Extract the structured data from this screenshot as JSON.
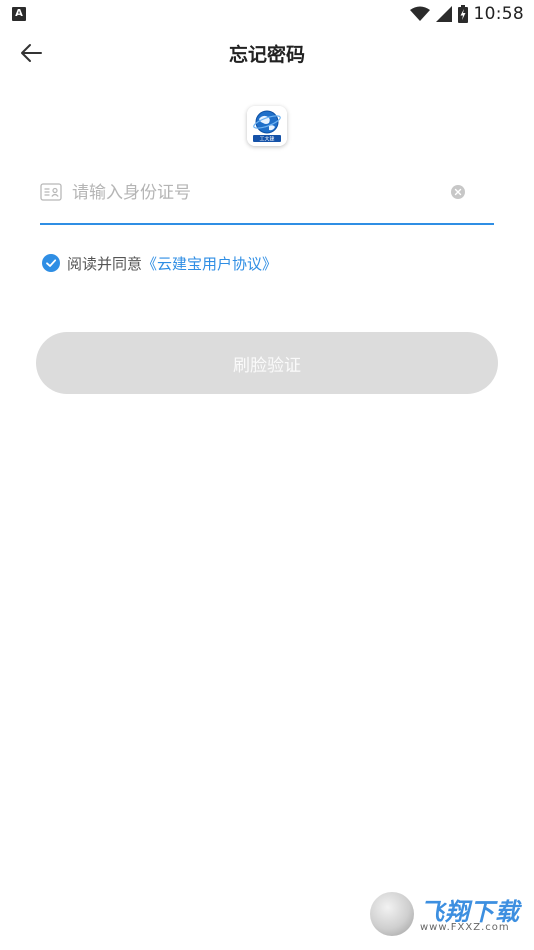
{
  "status_bar": {
    "notification_letter": "A",
    "time": "10:58",
    "icons": [
      "wifi-icon",
      "cellular-signal-icon",
      "battery-charging-icon"
    ]
  },
  "header": {
    "title": "忘记密码",
    "back_icon": "arrow-left-icon"
  },
  "logo": {
    "caption": "工大建"
  },
  "id_input": {
    "placeholder": "请输入身份证号",
    "value": "",
    "icon": "id-card-icon",
    "clear_icon": "clear-icon"
  },
  "agreement": {
    "checked": true,
    "text": "阅读并同意",
    "link": "《云建宝用户协议》"
  },
  "face_verify_button": {
    "label": "刷脸验证"
  },
  "watermark": {
    "brand": "飞翔下载",
    "url": "www.FXXZ.com"
  },
  "colors": {
    "accent": "#2f8ee4",
    "button_disabled": "#dcdcdc",
    "placeholder": "#b5b5b5"
  }
}
